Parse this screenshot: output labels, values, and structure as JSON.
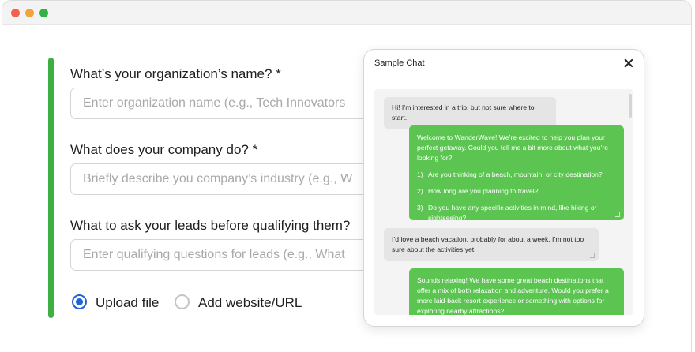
{
  "form": {
    "org_name": {
      "label": "What’s your organization’s name? *",
      "placeholder": "Enter organization name (e.g., Tech Innovators"
    },
    "company_do": {
      "label": "What does your company do? *",
      "placeholder": "Briefly describe you company’s industry (e.g., W"
    },
    "qualify": {
      "label": "What to ask your leads before qualifying them?",
      "placeholder": "Enter qualifying questions for leads (e.g., What"
    },
    "source_options": [
      {
        "label": "Upload file",
        "selected": true
      },
      {
        "label": "Add website/URL",
        "selected": false
      }
    ]
  },
  "chat": {
    "title": "Sample Chat",
    "messages": [
      {
        "role": "user",
        "text": "Hi! I’m interested in a trip, but not sure where to start."
      },
      {
        "role": "bot",
        "text": "Welcome to WanderWave! We’re excited to help you plan your perfect getaway. Could you tell me a bit more about what you’re looking for?",
        "items": [
          {
            "num": "1)",
            "text": "Are you thinking of a beach, mountain, or city destination?"
          },
          {
            "num": "2)",
            "text": "How long are you planning to travel?"
          },
          {
            "num": "3)",
            "text": "Do you have any specific activities in mind, like hiking or sightseeing?"
          }
        ]
      },
      {
        "role": "user",
        "text": "I’d love a beach vacation, probably for about a week. I’m not too sure about the activities yet."
      },
      {
        "role": "bot",
        "text": "Sounds relaxing! We have some great beach destinations that offer a mix of both relaxation and adventure. Would you prefer a more laid-back resort experience or something with options for exploring nearby attractions?"
      }
    ]
  },
  "colors": {
    "accent_green": "#3faf44",
    "bot_bubble": "#5cc551",
    "radio_blue": "#1c64d8"
  }
}
